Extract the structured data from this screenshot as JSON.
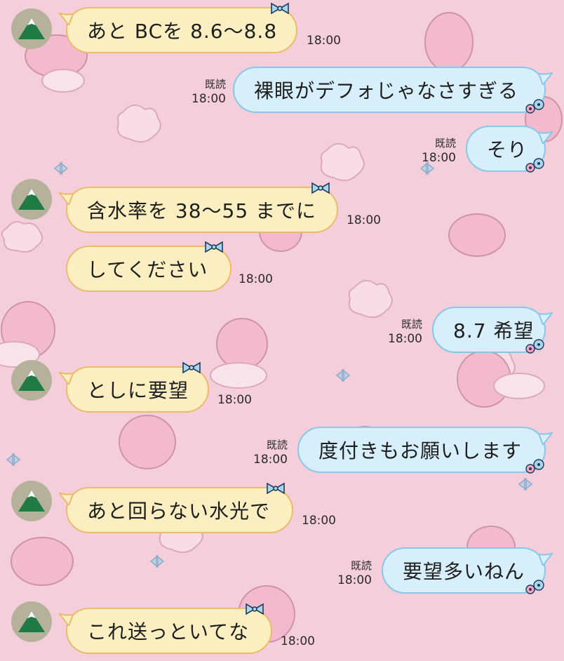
{
  "chat": {
    "messages": [
      {
        "id": "m1",
        "side": "in",
        "text": "あと BCを 8.6〜8.8",
        "time": "18:00"
      },
      {
        "id": "m2",
        "side": "out",
        "text": "裸眼がデフォじゃなさすぎる",
        "time": "18:00",
        "read": "既読"
      },
      {
        "id": "m3",
        "side": "out",
        "text": "そり",
        "time": "18:00",
        "read": "既読"
      },
      {
        "id": "m4",
        "side": "in",
        "text": "含水率を 38〜55 までに",
        "time": "18:00"
      },
      {
        "id": "m5",
        "side": "in",
        "text": "してください",
        "time": "18:00"
      },
      {
        "id": "m6",
        "side": "out",
        "text": "8.7 希望",
        "time": "18:00",
        "read": "既読"
      },
      {
        "id": "m7",
        "side": "in",
        "text": "としに要望",
        "time": "18:00"
      },
      {
        "id": "m8",
        "side": "out",
        "text": "度付きもお願いします",
        "time": "18:00",
        "read": "既読"
      },
      {
        "id": "m9",
        "side": "in",
        "text": "あと回らない水光で",
        "time": "18:00"
      },
      {
        "id": "m10",
        "side": "out",
        "text": "要望多いねん",
        "time": "18:00",
        "read": "既読"
      },
      {
        "id": "m11",
        "side": "in",
        "text": "これ送っといてな",
        "time": "18:00"
      }
    ]
  },
  "icons": {
    "avatar": "mountain-avatar-icon",
    "bubble_decor_in": "ribbon-icon",
    "bubble_decor_out": "flowers-icon"
  },
  "colors": {
    "background": "#f4cfdb",
    "incoming_bubble": "#fbeec0",
    "incoming_border": "#eabb6c",
    "outgoing_bubble": "#d7eefb",
    "outgoing_border": "#88c6ea"
  }
}
